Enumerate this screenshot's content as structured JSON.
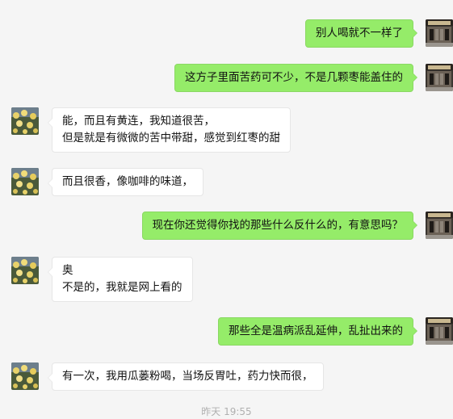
{
  "messages": [
    {
      "side": "out",
      "lines": [
        "别人喝就不一样了"
      ]
    },
    {
      "side": "out",
      "lines": [
        "这方子里面苦药可不少，不是几颗枣能盖住的"
      ]
    },
    {
      "side": "in",
      "lines": [
        "能，而且有黄连，我知道很苦，",
        "但是就是有微微的苦中带甜，感觉到红枣的甜"
      ]
    },
    {
      "side": "in",
      "lines": [
        "而且很香，像咖啡的味道，"
      ]
    },
    {
      "side": "out",
      "lines": [
        "现在你还觉得你找的那些什么反什么的，有意思吗？"
      ]
    },
    {
      "side": "in",
      "lines": [
        "奥",
        "不是的，我就是网上看的"
      ]
    },
    {
      "side": "out",
      "lines": [
        "那些全是温病派乱延伸，乱扯出来的"
      ]
    },
    {
      "side": "in",
      "lines": [
        "有一次，我用瓜蒌粉喝，当场反胃吐，药力快而很，"
      ]
    }
  ],
  "timestamp": "昨天 19:55",
  "colors": {
    "background": "#f5f5f5",
    "outgoing_bubble": "#95ec69",
    "incoming_bubble": "#ffffff"
  },
  "icons": {
    "incoming_avatar": "flowers-avatar-icon",
    "outgoing_avatar": "building-avatar-icon"
  }
}
